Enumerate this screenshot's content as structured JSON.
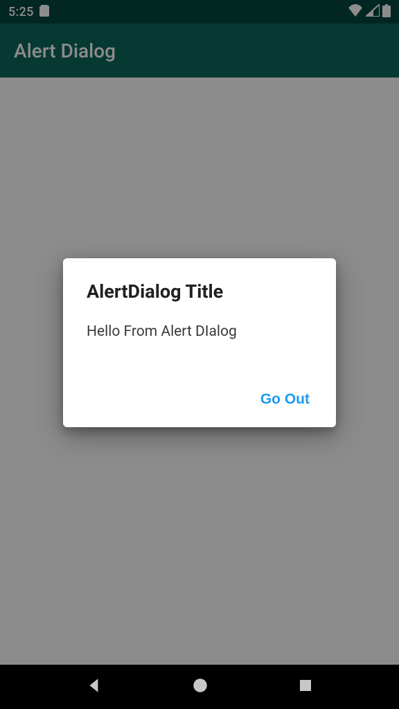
{
  "status_bar": {
    "time": "5:25"
  },
  "app_bar": {
    "title": "Alert Dialog"
  },
  "dialog": {
    "title": "AlertDialog Title",
    "message": "Hello From Alert DIalog",
    "action_label": "Go Out"
  }
}
